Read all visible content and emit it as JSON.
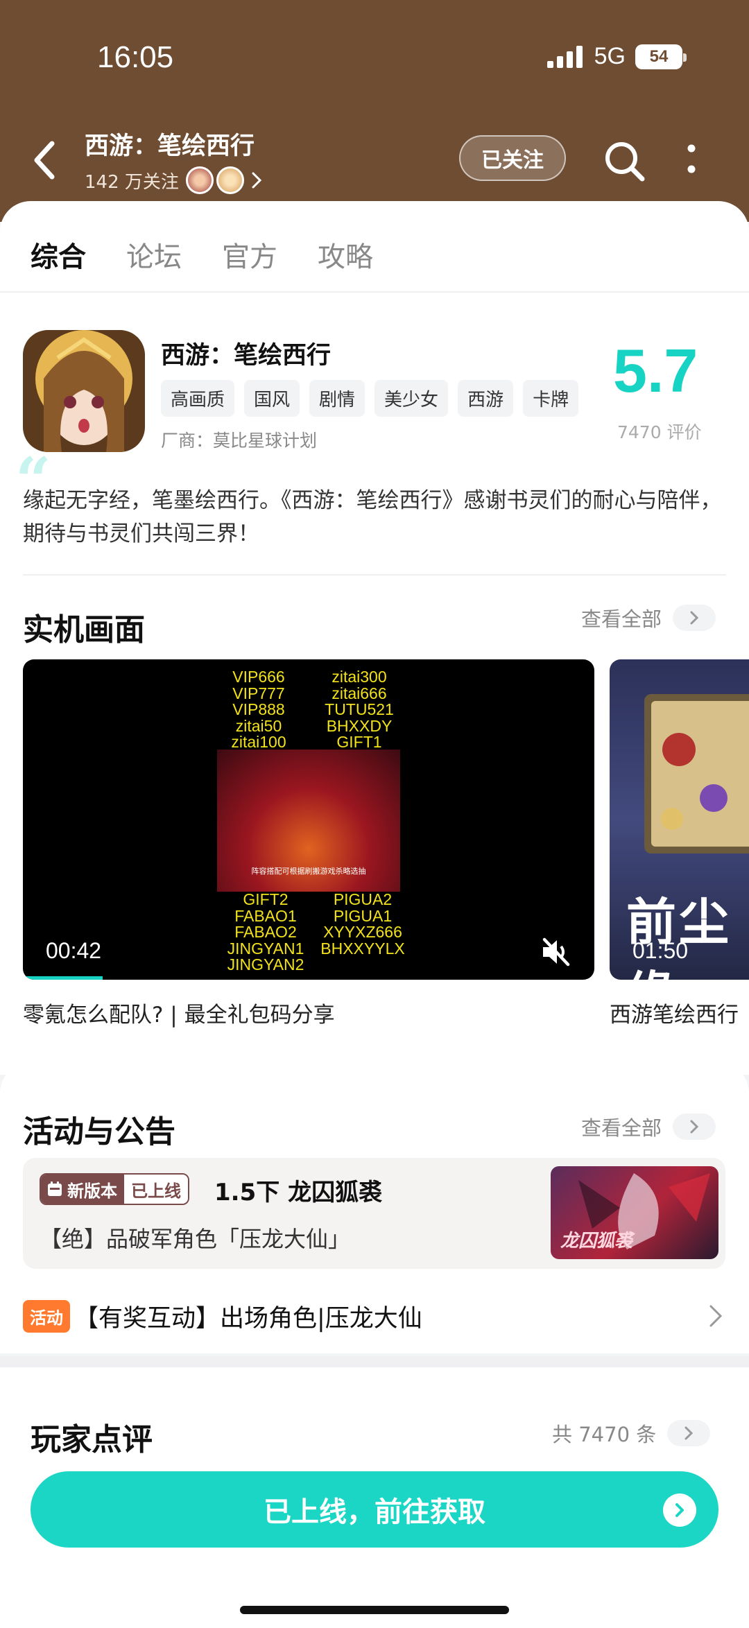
{
  "status": {
    "time": "16:05",
    "network": "5G",
    "battery": "54"
  },
  "header": {
    "title": "西游：笔绘西行",
    "followers": "142 万关注",
    "follow_button": "已关注"
  },
  "tabs": [
    "综合",
    "论坛",
    "官方",
    "攻略"
  ],
  "game": {
    "name": "西游：笔绘西行",
    "tags": [
      "高画质",
      "国风",
      "剧情",
      "美少女",
      "西游",
      "卡牌"
    ],
    "maker": "厂商：莫比星球计划",
    "score": "5.7",
    "rating_count": "7470 评价",
    "description": "缘起无字经，笔墨绘西行。《西游：笔绘西行》感谢书灵们的耐心与陪伴，期待与书灵们共闯三界！"
  },
  "screenshots": {
    "title": "实机画面",
    "view_all": "查看全部",
    "videos": [
      {
        "duration": "00:42",
        "caption": "零氪怎么配队? | 最全礼包码分享",
        "codes_top_left": [
          "VIP666",
          "VIP777",
          "VIP888",
          "zitai50",
          "zitai100"
        ],
        "codes_top_right": [
          "zitai300",
          "zitai666",
          "TUTU521",
          "BHXXDY",
          "GIFT1"
        ],
        "codes_bottom_left": [
          "GIFT2",
          "FABAO1",
          "FABAO2",
          "JINGYAN1",
          "JINGYAN2"
        ],
        "codes_bottom_right": [
          "PIGUA2",
          "PIGUA1",
          "XYYXZ666",
          "BHXXYYLX"
        ],
        "subtitle": "阵容搭配可根据刷搬游戏杀略选抽",
        "progress": 0.14
      },
      {
        "duration": "01:50",
        "caption": "西游笔绘西行",
        "overlay_text": "前尘缘"
      }
    ]
  },
  "news": {
    "title": "活动与公告",
    "view_all": "查看全部",
    "card": {
      "badge_left": "新版本",
      "badge_right": "已上线",
      "title": "1.5下 龙囚狐裘",
      "subtitle": "【绝】品破军角色「压龙大仙」",
      "thumb_text": "龙囚狐裘"
    },
    "activity": {
      "badge": "活动",
      "text": "【有奖互动】出场角色|压龙大仙"
    }
  },
  "reviews": {
    "title": "玩家点评",
    "count": "共 7470 条"
  },
  "cta": {
    "label": "已上线，前往获取"
  },
  "colors": {
    "accent": "#1bd6c5",
    "header_bg": "#6e4d33",
    "activity": "#ff7a2e"
  }
}
